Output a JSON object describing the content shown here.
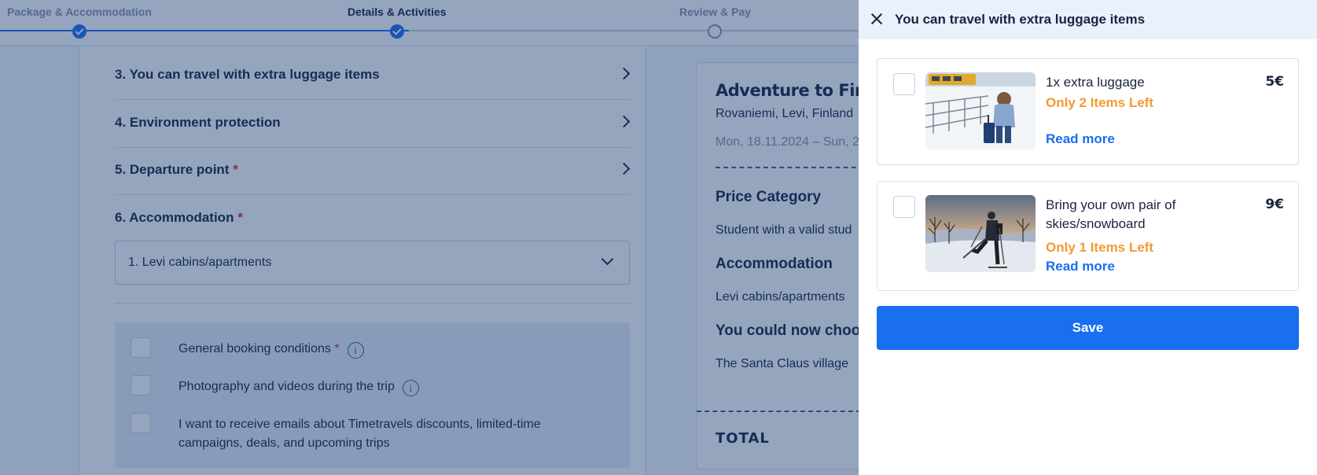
{
  "stepper": {
    "steps": [
      {
        "label": "Package & Accommodation",
        "state": "done"
      },
      {
        "label": "Details & Activities",
        "state": "done"
      },
      {
        "label": "Review & Pay",
        "state": "todo"
      }
    ]
  },
  "form": {
    "sections": [
      {
        "title": "3. You can travel with extra luggage items",
        "required": false
      },
      {
        "title": "4. Environment protection",
        "required": false
      },
      {
        "title": "5. Departure point",
        "required": true
      }
    ],
    "accommodation": {
      "title": "6. Accommodation",
      "required_mark": "*",
      "selected": "1. Levi cabins/apartments"
    },
    "consents": [
      {
        "text": "General booking conditions",
        "required_mark": "*",
        "info": true
      },
      {
        "text": "Photography and videos during the trip",
        "info": true
      },
      {
        "text": "I want to receive emails about Timetravels discounts, limited-time campaigns, deals, and upcoming trips"
      }
    ]
  },
  "summary": {
    "title": "Adventure to Finnis",
    "location": "Rovaniemi, Levi, Finland",
    "dates": "Mon, 18.11.2024 – Sun, 2",
    "price_category_heading": "Price Category",
    "price_category": "Student with a valid stud",
    "accommodation_heading": "Accommodation",
    "accommodation": "Levi cabins/apartments",
    "choose_heading": "You could now choos",
    "choose_value": "The Santa Claus village",
    "total_label": "TOTAL"
  },
  "drawer": {
    "title": "You can travel with extra luggage items",
    "items": [
      {
        "name": "1x extra luggage",
        "stock": "Only 2 Items Left",
        "read_more": "Read more",
        "price": "5€",
        "image": "traveler-with-suitcase-in-snow"
      },
      {
        "name": "Bring your own pair of skies/snowboard",
        "stock": "Only 1 Items Left",
        "read_more": "Read more",
        "price": "9€",
        "image": "skier-in-winter-landscape"
      }
    ],
    "save_label": "Save"
  },
  "colors": {
    "accent": "#1a6ef0",
    "stock_warning": "#f39a33",
    "text_dark": "#1a2340",
    "required": "#d92b2b",
    "overlay": "#14376e"
  }
}
